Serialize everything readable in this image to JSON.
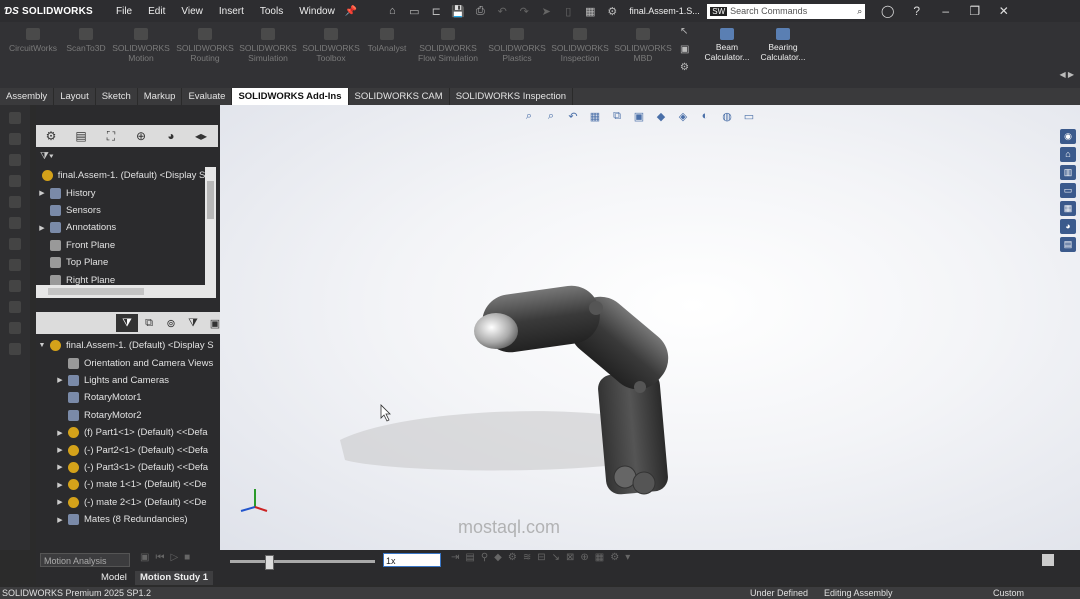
{
  "app": {
    "brand": "SOLIDWORKS",
    "doc_title": "final.Assem-1.S..."
  },
  "menu": [
    "File",
    "Edit",
    "View",
    "Insert",
    "Tools",
    "Window"
  ],
  "search": {
    "badge": "SW",
    "placeholder": "Search Commands"
  },
  "ribbon": {
    "items": [
      {
        "label": "CircuitWorks"
      },
      {
        "label": "ScanTo3D"
      },
      {
        "label": "SOLIDWORKS Motion"
      },
      {
        "label": "SOLIDWORKS Routing"
      },
      {
        "label": "SOLIDWORKS Simulation"
      },
      {
        "label": "SOLIDWORKS Toolbox"
      },
      {
        "label": "TolAnalyst"
      },
      {
        "label": "SOLIDWORKS Flow Simulation"
      },
      {
        "label": "SOLIDWORKS Plastics"
      },
      {
        "label": "SOLIDWORKS Inspection"
      },
      {
        "label": "SOLIDWORKS MBD"
      }
    ],
    "calculators": [
      {
        "label": "Beam Calculator..."
      },
      {
        "label": "Bearing Calculator..."
      }
    ]
  },
  "tabs": [
    "Assembly",
    "Layout",
    "Sketch",
    "Markup",
    "Evaluate",
    "SOLIDWORKS Add-Ins",
    "SOLIDWORKS CAM",
    "SOLIDWORKS Inspection"
  ],
  "active_tab": "SOLIDWORKS Add-Ins",
  "tree_top": [
    {
      "label": "final.Assem-1. (Default) <Display St",
      "toggle": ""
    },
    {
      "label": "History",
      "toggle": "▶"
    },
    {
      "label": "Sensors",
      "toggle": ""
    },
    {
      "label": "Annotations",
      "toggle": "▶"
    },
    {
      "label": "Front Plane",
      "toggle": ""
    },
    {
      "label": "Top Plane",
      "toggle": ""
    },
    {
      "label": "Right Plane",
      "toggle": ""
    }
  ],
  "tree_motion": [
    {
      "label": "final.Assem-1. (Default) <Display S",
      "toggle": "▼"
    },
    {
      "label": "Orientation and Camera Views",
      "toggle": ""
    },
    {
      "label": "Lights and Cameras",
      "toggle": "▶"
    },
    {
      "label": "RotaryMotor1",
      "toggle": ""
    },
    {
      "label": "RotaryMotor2",
      "toggle": ""
    },
    {
      "label": "(f) Part1<1> (Default) <<Defa",
      "toggle": "▶"
    },
    {
      "label": "(-) Part2<1> (Default) <<Defa",
      "toggle": "▶"
    },
    {
      "label": "(-) Part3<1> (Default) <<Defa",
      "toggle": "▶"
    },
    {
      "label": "(-) mate 1<1> (Default) <<De",
      "toggle": "▶"
    },
    {
      "label": "(-) mate 2<1> (Default) <<De",
      "toggle": "▶"
    },
    {
      "label": "Mates (8 Redundancies)",
      "toggle": "▶"
    }
  ],
  "motion": {
    "study_type": "Motion Analysis",
    "speed": "1x",
    "slider_position": 0.25
  },
  "bottom_tabs": [
    "Model",
    "Motion Study 1"
  ],
  "watermark": "mostaql.com",
  "status": {
    "product": "SOLIDWORKS Premium 2025 SP1.2",
    "state1": "Under Defined",
    "state2": "Editing Assembly",
    "units": "Custom"
  },
  "colors": {
    "accent": "#3a77c7",
    "active_tab_bg": "#ffffff",
    "chrome": "#2d2d30"
  }
}
